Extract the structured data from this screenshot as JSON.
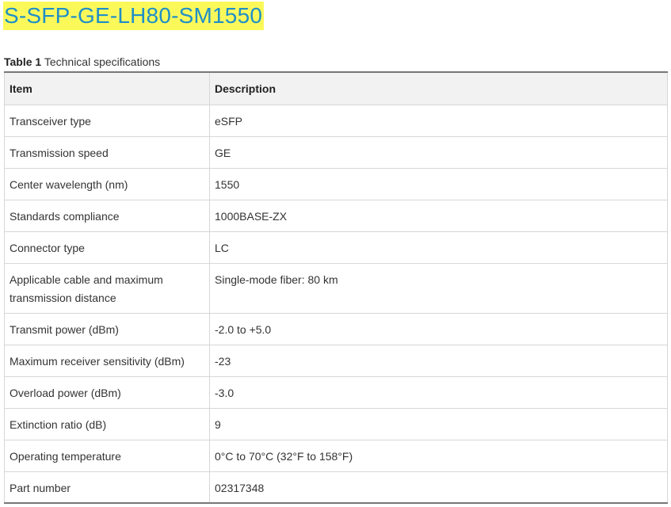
{
  "page": {
    "title": "S-SFP-GE-LH80-SM1550",
    "title_highlight_color": "#fbf95a",
    "title_text_color": "#1f8fc7"
  },
  "table": {
    "caption_label": "Table 1",
    "caption_text": " Technical specifications",
    "headers": [
      "Item",
      "Description"
    ],
    "rows": [
      {
        "item": "Transceiver type",
        "description": "eSFP"
      },
      {
        "item": "Transmission speed",
        "description": "GE"
      },
      {
        "item": "Center wavelength (nm)",
        "description": "1550"
      },
      {
        "item": "Standards compliance",
        "description": "1000BASE-ZX"
      },
      {
        "item": "Connector type",
        "description": "LC"
      },
      {
        "item": "Applicable cable and maximum transmission distance",
        "description": "Single-mode fiber: 80 km"
      },
      {
        "item": "Transmit power (dBm)",
        "description": "-2.0 to +5.0"
      },
      {
        "item": "Maximum receiver sensitivity (dBm)",
        "description": "-23"
      },
      {
        "item": "Overload power (dBm)",
        "description": "-3.0"
      },
      {
        "item": "Extinction ratio (dB)",
        "description": "9"
      },
      {
        "item": "Operating temperature",
        "description": "0°C to 70°C (32°F to 158°F)"
      },
      {
        "item": "Part number",
        "description": "02317348"
      }
    ]
  }
}
